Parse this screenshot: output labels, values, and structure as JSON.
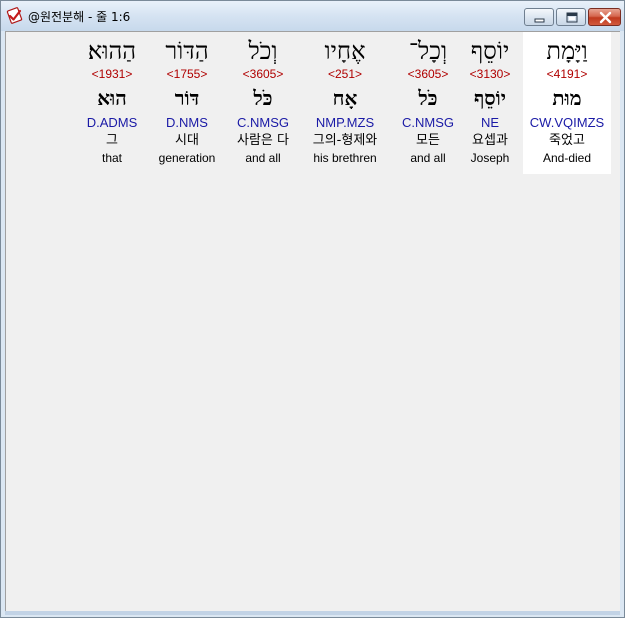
{
  "window": {
    "title": "@원전분해 - 줄 1:6",
    "app_icon": "checkmark-app-icon",
    "controls": {
      "minimize_icon": "minimize-icon",
      "maximize_icon": "maximize-icon",
      "close_icon": "close-icon"
    }
  },
  "colors": {
    "strong": "#b00000",
    "parsing": "#1a1aa6",
    "background": "#f0f0f0",
    "highlight": "#ffffff"
  },
  "words": [
    {
      "hebrew": "הַהוּא׃",
      "strong": "<1931>",
      "lemma": "הוּא",
      "parsing": "D.ADMS",
      "korean": "그",
      "english": "that"
    },
    {
      "hebrew": "הַדּוֹר",
      "strong": "<1755>",
      "lemma": "דּוֹר",
      "parsing": "D.NMS",
      "korean": "시대",
      "english": "generation"
    },
    {
      "hebrew": "וְכֹל",
      "strong": "<3605>",
      "lemma": "כֹּל",
      "parsing": "C.NMSG",
      "korean": "사람은 다",
      "english": "and all"
    },
    {
      "hebrew": "אֶחָיו",
      "strong": "<251>",
      "lemma": "אָח",
      "parsing": "NMP.MZS",
      "korean": "그의-형제와",
      "english": "his brethren"
    },
    {
      "hebrew": "וְכָל־",
      "strong": "<3605>",
      "lemma": "כֹּל",
      "parsing": "C.NMSG",
      "korean": "모든",
      "english": "and all"
    },
    {
      "hebrew": "יוֹסֵף",
      "strong": "<3130>",
      "lemma": "יוֹסֵף",
      "parsing": "NE",
      "korean": "요셉과",
      "english": "Joseph"
    },
    {
      "hebrew": "וַיָּמָת",
      "strong": "<4191>",
      "lemma": "מוּת",
      "parsing": "CW.VQIMZS",
      "korean": "죽었고",
      "english": "And-died",
      "selected": true
    }
  ]
}
